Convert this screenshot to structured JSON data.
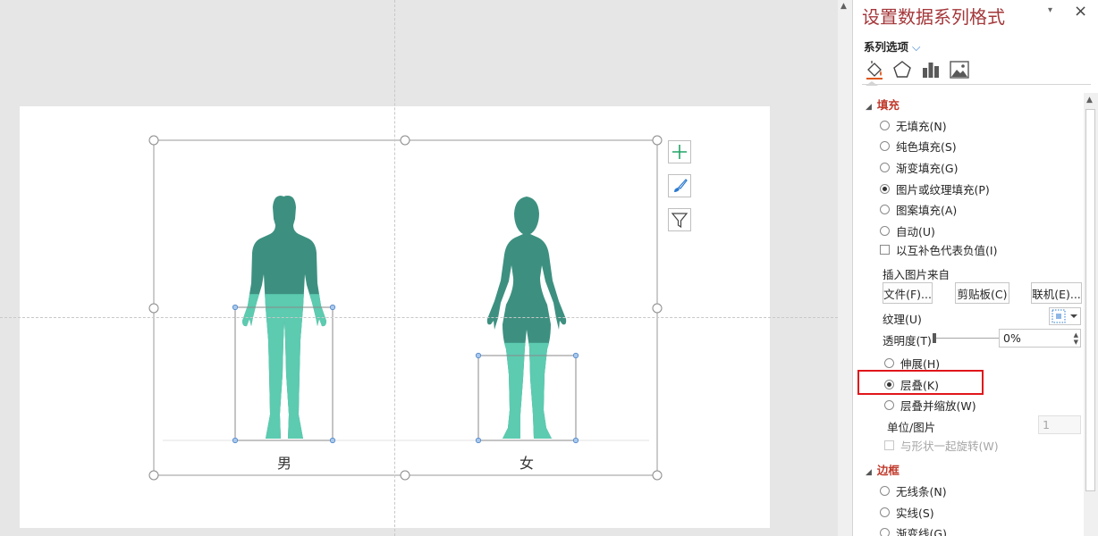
{
  "chart": {
    "categories": [
      "男",
      "女"
    ],
    "accent_dark": "#3d9080",
    "accent_light": "#5ccbb0",
    "fill_fraction": [
      0.6,
      0.4
    ]
  },
  "chart_tools": {
    "add_element_icon": "plus-icon",
    "style_icon": "paintbrush-icon",
    "filter_icon": "funnel-icon"
  },
  "pane": {
    "title": "设置数据系列格式",
    "series_options_label": "系列选项",
    "tabs": [
      "fill-line-icon",
      "effects-icon",
      "series-options-icon",
      "picture-icon"
    ],
    "fill_section": "填充",
    "fill_options": [
      {
        "label": "无填充(N)",
        "selected": false
      },
      {
        "label": "纯色填充(S)",
        "selected": false
      },
      {
        "label": "渐变填充(G)",
        "selected": false
      },
      {
        "label": "图片或纹理填充(P)",
        "selected": true
      },
      {
        "label": "图案填充(A)",
        "selected": false
      },
      {
        "label": "自动(U)",
        "selected": false
      }
    ],
    "invert_negative": "以互补色代表负值(I)",
    "insert_picture_from": "插入图片来自",
    "file_button": "文件(F)...",
    "clipboard_button": "剪贴板(C)",
    "online_button": "联机(E)...",
    "texture_label": "纹理(U)",
    "transparency_label": "透明度(T)",
    "transparency_value": "0%",
    "stretch_label": "伸展(H)",
    "stack_label": "层叠(K)",
    "stack_scale_label": "层叠并缩放(W)",
    "units_label": "单位/图片",
    "units_value": "1",
    "rotate_with_shape": "与形状一起旋转(W)",
    "border_section": "边框",
    "border_options": [
      {
        "label": "无线条(N)",
        "selected": false
      },
      {
        "label": "实线(S)",
        "selected": false
      },
      {
        "label": "渐变线(G)",
        "selected": false
      }
    ]
  }
}
